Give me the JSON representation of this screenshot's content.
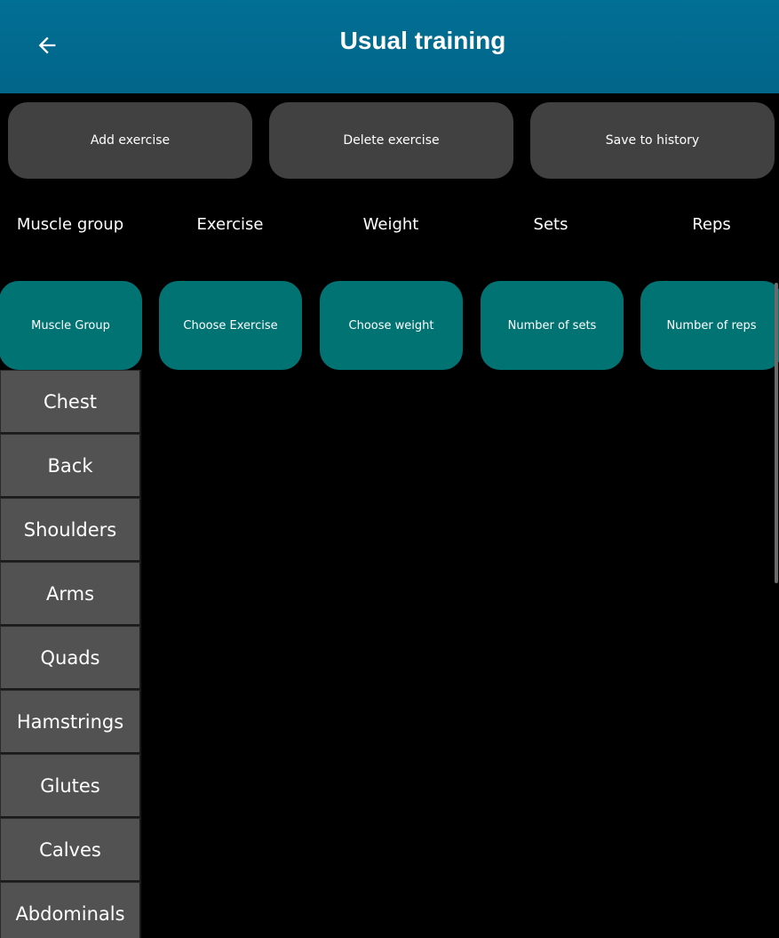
{
  "appbar": {
    "title": "Usual training",
    "back_icon": "arrow-left-icon"
  },
  "actions": {
    "add_label": "Add exercise",
    "delete_label": "Delete exercise",
    "save_label": "Save to history"
  },
  "columns": {
    "muscle_group": "Muscle group",
    "exercise": "Exercise",
    "weight": "Weight",
    "sets": "Sets",
    "reps": "Reps"
  },
  "selectors": {
    "muscle_group": "Muscle Group",
    "exercise": "Choose Exercise",
    "weight": "Choose weight",
    "sets": "Number of sets",
    "reps": "Number of reps"
  },
  "muscle_groups": [
    "Chest",
    "Back",
    "Shoulders",
    "Arms",
    "Quads",
    "Hamstrings",
    "Glutes",
    "Calves",
    "Abdominals"
  ],
  "colors": {
    "appbar": "#026f94",
    "button_gray": "#414141",
    "button_teal": "#027373",
    "dropdown_item": "#525252",
    "background": "#000000"
  }
}
